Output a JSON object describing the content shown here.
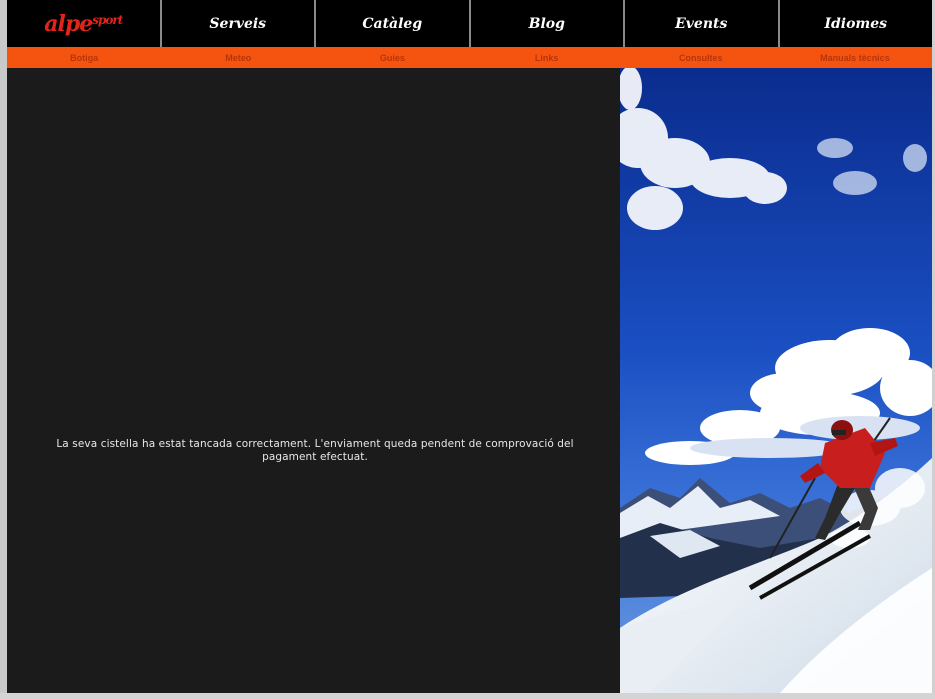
{
  "header": {
    "logo": {
      "text": "alpe",
      "sup": "sport"
    },
    "nav": [
      {
        "label": "Serveis"
      },
      {
        "label": "Catàleg"
      },
      {
        "label": "Blog"
      },
      {
        "label": "Events"
      },
      {
        "label": "Idiomes"
      }
    ]
  },
  "subnav": [
    {
      "label": "Botiga"
    },
    {
      "label": "Meteo"
    },
    {
      "label": "Guies"
    },
    {
      "label": "Links"
    },
    {
      "label": "Consultes"
    },
    {
      "label": "Manuals tècnics"
    }
  ],
  "main": {
    "message": "La seva cistella ha estat tancada correctament. L'enviament queda pendent de comprovació del pagament efectuat."
  },
  "colors": {
    "nav_bg": "#000000",
    "subnav_bg": "#f45410",
    "logo": "#e2241b",
    "content_bg": "#1b1b1b"
  },
  "photo": {
    "subject": "skier-descending-snow-slope-blue-sky"
  }
}
